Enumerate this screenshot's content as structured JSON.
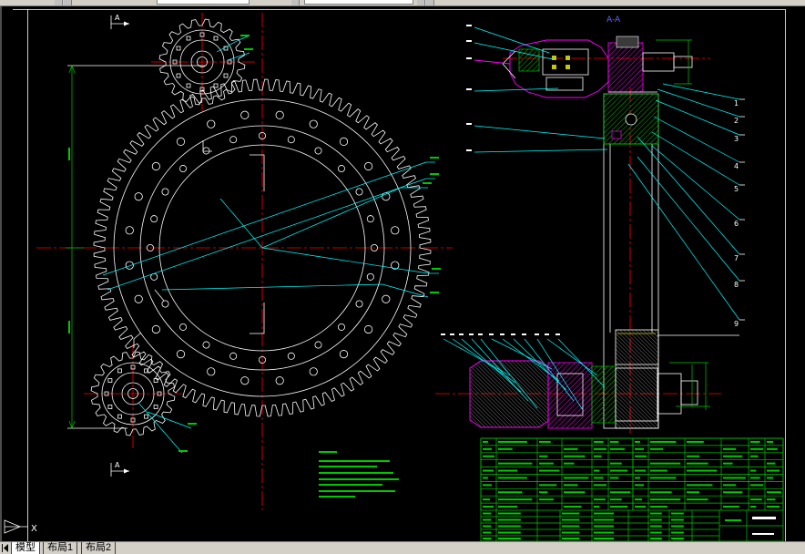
{
  "drawing": {
    "section_title": "A-A",
    "section_marker_top": "A",
    "section_marker_bottom": "A",
    "balloons_right": [
      "1",
      "2",
      "3",
      "4",
      "5",
      "6",
      "7",
      "8",
      "9"
    ],
    "ucs_axis_label": "X"
  },
  "layout_tabs": [
    {
      "label": "模型",
      "active": true
    },
    {
      "label": "布局1",
      "active": false
    },
    {
      "label": "布局2",
      "active": false
    }
  ],
  "icons": {
    "tab_navigation": "tab-first-icon",
    "ucs": "ucs-icon"
  },
  "colors": {
    "background": "#000000",
    "object_line": "#ffffff",
    "center_line": "#ff0000",
    "leader_line": "#00ffff",
    "section_part": "#ff00ff",
    "dimension": "#00c800",
    "section_title": "#6464ff",
    "ui_chrome": "#d4d0c8",
    "accent": "#c8c800"
  }
}
